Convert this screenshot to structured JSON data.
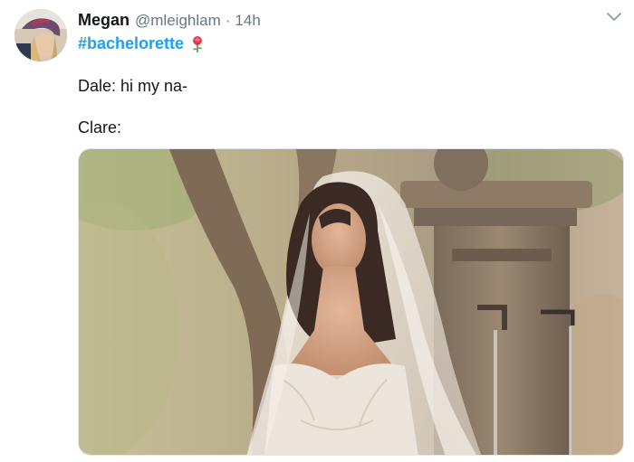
{
  "tweet": {
    "display_name": "Megan",
    "handle": "@mleighlam",
    "separator": "·",
    "timestamp": "14h",
    "hashtag": "#bachelorette",
    "hashtag_emoji": "rose-emoji",
    "lines": [
      "Dale: hi my na-",
      "Clare:"
    ],
    "media_description_icon": "photo-of-bride-in-veil"
  },
  "colors": {
    "link": "#1da1f2",
    "text": "#14171a",
    "muted": "#657786"
  }
}
